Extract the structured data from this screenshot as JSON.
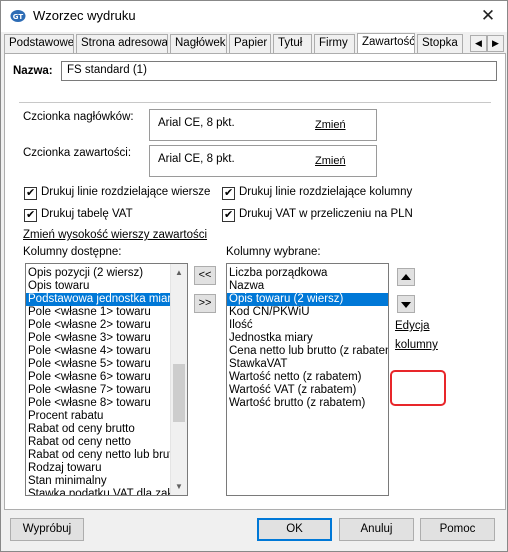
{
  "window": {
    "title": "Wzorzec wydruku"
  },
  "tabs": [
    {
      "label": "Podstawowe"
    },
    {
      "label": "Strona adresowa"
    },
    {
      "label": "Nagłówek"
    },
    {
      "label": "Papier"
    },
    {
      "label": "Tytuł"
    },
    {
      "label": "Firmy"
    },
    {
      "label": "Zawartość",
      "active": true
    },
    {
      "label": "Stopka"
    }
  ],
  "tab_scroll": {
    "left": "◀",
    "right": "▶"
  },
  "name": {
    "label": "Nazwa:",
    "value": "FS standard (1)"
  },
  "fonts": {
    "header_label": "Czcionka nagłówków:",
    "header_value": "Arial CE, 8 pkt.",
    "header_change": "Zmień",
    "content_label": "Czcionka zawartości:",
    "content_value": "Arial CE, 8 pkt.",
    "content_change": "Zmień"
  },
  "checks": {
    "row_lines": "Drukuj linie rozdzielające wiersze",
    "col_lines": "Drukuj linie rozdzielające kolumny",
    "vat_table": "Drukuj tabelę VAT",
    "vat_pln": "Drukuj VAT w przeliczeniu na PLN"
  },
  "change_row_height": "Zmień wysokość wierszy zawartości",
  "available": {
    "label": "Kolumny dostępne:",
    "items": [
      "Opis pozycji (2 wiersz)",
      "Opis towaru",
      "Podstawowa jednostka miary",
      "Pole <własne 1> towaru",
      "Pole <własne 2> towaru",
      "Pole <własne 3> towaru",
      "Pole <własne 4> towaru",
      "Pole <własne 5> towaru",
      "Pole <własne 6> towaru",
      "Pole <własne 7> towaru",
      "Pole <własne 8> towaru",
      "Procent rabatu",
      "Rabat od ceny brutto",
      "Rabat od ceny netto",
      "Rabat od ceny netto lub brutto",
      "Rodzaj towaru",
      "Stan minimalny",
      "Stawka podatku VAT dla zakupu"
    ],
    "selected_index": 2
  },
  "move_buttons": {
    "remove": "<<",
    "add": ">>"
  },
  "chosen": {
    "label": "Kolumny wybrane:",
    "items": [
      "Liczba porządkowa",
      "Nazwa",
      "Opis towaru (2 wiersz)",
      "Kod CN/PKWiU",
      "Ilość",
      "Jednostka miary",
      "Cena netto lub brutto (z rabatem)",
      "StawkaVAT",
      "Wartość netto (z rabatem)",
      "Wartość VAT (z rabatem)",
      "Wartość brutto (z rabatem)"
    ],
    "selected_index": 2
  },
  "edit_columns": {
    "line1": "Edycja",
    "line2": "kolumny"
  },
  "buttons": {
    "try": "Wypróbuj",
    "ok": "OK",
    "cancel": "Anuluj",
    "help": "Pomoc"
  },
  "colors": {
    "selection": "#0078d7",
    "highlight": "#e8262a"
  }
}
